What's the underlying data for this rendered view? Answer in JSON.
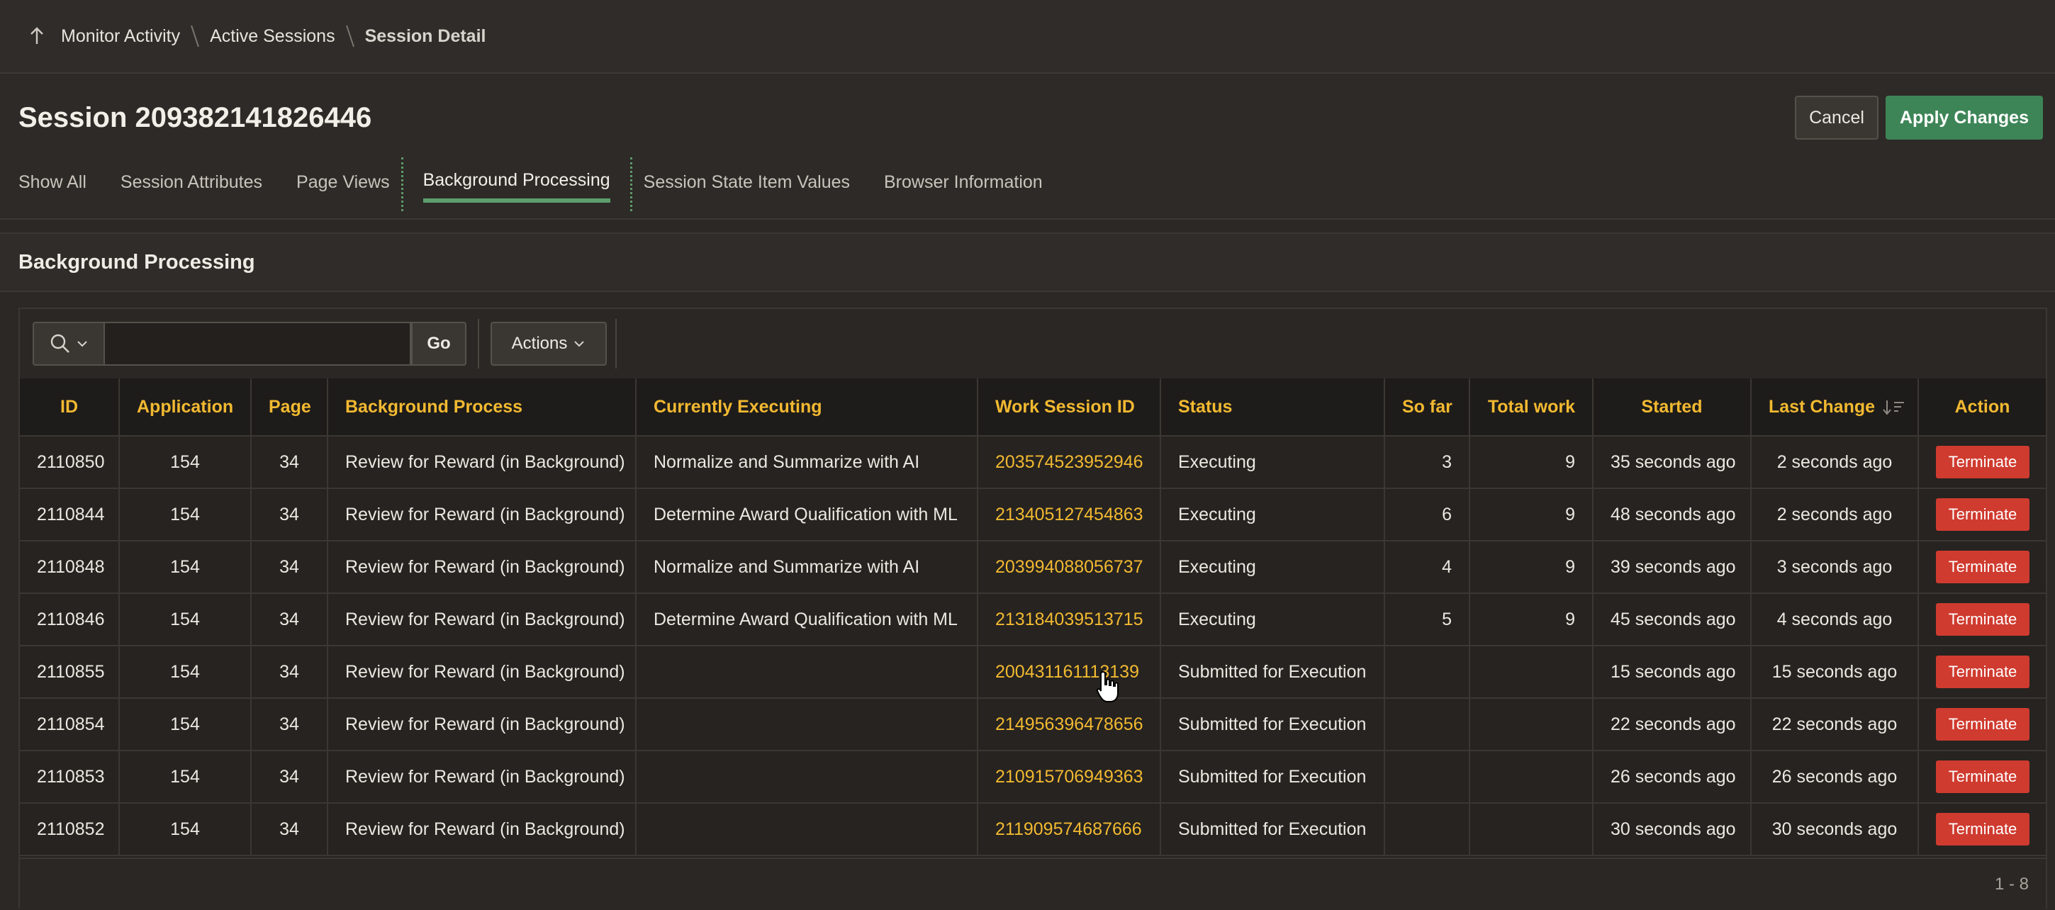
{
  "breadcrumb": {
    "items": [
      "Monitor Activity",
      "Active Sessions"
    ],
    "current": "Session Detail"
  },
  "page": {
    "title": "Session 209382141826446",
    "cancel_label": "Cancel",
    "apply_label": "Apply Changes"
  },
  "tabs": [
    {
      "label": "Show All"
    },
    {
      "label": "Session Attributes"
    },
    {
      "label": "Page Views"
    },
    {
      "label": "Background Processing",
      "active": true
    },
    {
      "label": "Session State Item Values"
    },
    {
      "label": "Browser Information"
    }
  ],
  "region": {
    "title": "Background Processing"
  },
  "toolbar": {
    "go_label": "Go",
    "actions_label": "Actions",
    "search_value": ""
  },
  "table": {
    "columns": [
      "ID",
      "Application",
      "Page",
      "Background Process",
      "Currently Executing",
      "Work Session ID",
      "Status",
      "So far",
      "Total work",
      "Started",
      "Last Change",
      "Action"
    ],
    "rows": [
      [
        "2110850",
        "154",
        "34",
        "Review for Reward (in Background)",
        "Normalize and Summarize with AI",
        "203574523952946",
        "Executing",
        "3",
        "9",
        "35 seconds ago",
        "2 seconds ago",
        "Terminate"
      ],
      [
        "2110844",
        "154",
        "34",
        "Review for Reward (in Background)",
        "Determine Award Qualification with ML",
        "213405127454863",
        "Executing",
        "6",
        "9",
        "48 seconds ago",
        "2 seconds ago",
        "Terminate"
      ],
      [
        "2110848",
        "154",
        "34",
        "Review for Reward (in Background)",
        "Normalize and Summarize with AI",
        "203994088056737",
        "Executing",
        "4",
        "9",
        "39 seconds ago",
        "3 seconds ago",
        "Terminate"
      ],
      [
        "2110846",
        "154",
        "34",
        "Review for Reward (in Background)",
        "Determine Award Qualification with ML",
        "213184039513715",
        "Executing",
        "5",
        "9",
        "45 seconds ago",
        "4 seconds ago",
        "Terminate"
      ],
      [
        "2110855",
        "154",
        "34",
        "Review for Reward (in Background)",
        "",
        "200431161113139",
        "Submitted for Execution",
        "",
        "",
        "15 seconds ago",
        "15 seconds ago",
        "Terminate"
      ],
      [
        "2110854",
        "154",
        "34",
        "Review for Reward (in Background)",
        "",
        "214956396478656",
        "Submitted for Execution",
        "",
        "",
        "22 seconds ago",
        "22 seconds ago",
        "Terminate"
      ],
      [
        "2110853",
        "154",
        "34",
        "Review for Reward (in Background)",
        "",
        "210915706949363",
        "Submitted for Execution",
        "",
        "",
        "26 seconds ago",
        "26 seconds ago",
        "Terminate"
      ],
      [
        "2110852",
        "154",
        "34",
        "Review for Reward (in Background)",
        "",
        "211909574687666",
        "Submitted for Execution",
        "",
        "",
        "30 seconds ago",
        "30 seconds ago",
        "Terminate"
      ]
    ]
  },
  "pagination": "1 - 8",
  "colors": {
    "accent": "#f2b931",
    "apply": "#3d8557",
    "terminate": "#cf3b2f",
    "active_tab": "#5e9e6e"
  },
  "icons": [
    "up-arrow-icon",
    "search-icon",
    "chevron-down-icon",
    "sort-descending-icon",
    "hand-cursor-icon"
  ]
}
